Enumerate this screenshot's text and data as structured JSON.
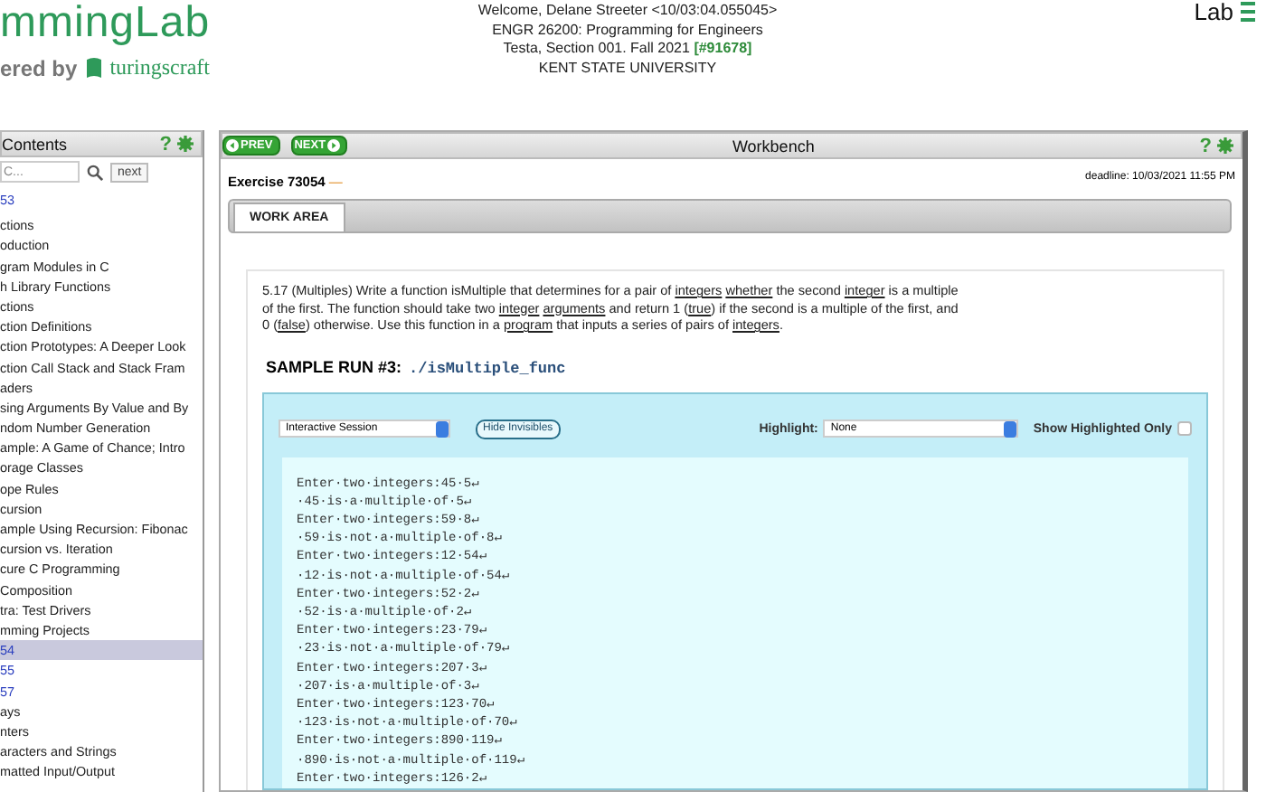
{
  "header": {
    "logo": "mmingLab",
    "powered_by": "ered by",
    "brand": "turingscraft",
    "course_lines": [
      "Welcome, Delane Streeter <10/03:04.055045>",
      "ENGR 26200: Programming for Engineers"
    ],
    "section": "Testa, Section 001. Fall 2021",
    "section_code": "[#91678]",
    "university": "KENT STATE UNIVERSITY",
    "menu_label": "Lab"
  },
  "sidebar": {
    "title": "Contents",
    "help": "?",
    "search": {
      "placeholder": "C..."
    },
    "next_button": "next",
    "items": [
      {
        "label": "53",
        "kind": "exercise",
        "selected": false
      },
      {
        "label": "ctions",
        "kind": "chapter",
        "selected": false
      },
      {
        "label": "oduction",
        "kind": "section",
        "selected": false
      },
      {
        "label": "gram Modules in C",
        "kind": "section",
        "selected": false
      },
      {
        "label": "h Library Functions",
        "kind": "section",
        "selected": false
      },
      {
        "label": "ctions",
        "kind": "section",
        "selected": false
      },
      {
        "label": "ction Definitions",
        "kind": "section",
        "selected": false
      },
      {
        "label": "ction Prototypes: A Deeper Look",
        "kind": "section",
        "selected": false
      },
      {
        "label": "ction Call Stack and Stack Fram",
        "kind": "section",
        "selected": false
      },
      {
        "label": "aders",
        "kind": "section",
        "selected": false
      },
      {
        "label": "sing Arguments By Value and By",
        "kind": "section",
        "selected": false
      },
      {
        "label": "ndom Number Generation",
        "kind": "section",
        "selected": false
      },
      {
        "label": "ample: A Game of Chance; Intro",
        "kind": "section",
        "selected": false
      },
      {
        "label": "orage Classes",
        "kind": "section",
        "selected": false
      },
      {
        "label": "ope Rules",
        "kind": "section",
        "selected": false
      },
      {
        "label": "cursion",
        "kind": "section",
        "selected": false
      },
      {
        "label": "ample Using Recursion: Fibonac",
        "kind": "section",
        "selected": false
      },
      {
        "label": "cursion vs. Iteration",
        "kind": "section",
        "selected": false
      },
      {
        "label": "cure C Programming",
        "kind": "section",
        "selected": false
      },
      {
        "label": "Composition",
        "kind": "section",
        "selected": false
      },
      {
        "label": "tra: Test Drivers",
        "kind": "section",
        "selected": false
      },
      {
        "label": "mming Projects",
        "kind": "section",
        "selected": false
      },
      {
        "label": "54",
        "kind": "exercise",
        "selected": true
      },
      {
        "label": "55",
        "kind": "exercise",
        "selected": false
      },
      {
        "label": "57",
        "kind": "exercise",
        "selected": false
      },
      {
        "label": "ays",
        "kind": "chapter",
        "selected": false
      },
      {
        "label": "nters",
        "kind": "chapter",
        "selected": false
      },
      {
        "label": "aracters and Strings",
        "kind": "chapter",
        "selected": false
      },
      {
        "label": "matted Input/Output",
        "kind": "chapter",
        "selected": false
      }
    ]
  },
  "workbench": {
    "prev": "PREV",
    "next": "NEXT",
    "title": "Workbench",
    "help": "?",
    "exercise": "Exercise 73054",
    "exercise_mark": "—",
    "deadline": "deadline: 10/03/2021 11:55 PM",
    "tabs": [
      {
        "label": "WORK AREA",
        "selected": true
      }
    ],
    "problem": [
      {
        "text": "5.17 (Multiples) Write a function isMultiple that determines for a pair of ",
        "kind": "plain"
      },
      {
        "text": "integers",
        "kind": "link"
      },
      {
        "text": "whether",
        "kind": "link"
      },
      {
        "text": " the second ",
        "kind": "plain"
      },
      {
        "text": "integer",
        "kind": "link"
      },
      {
        "text": " is a multiple of the first. The function should take two ",
        "kind": "plain"
      },
      {
        "text": "integer",
        "kind": "link"
      },
      {
        "text": "arguments",
        "kind": "link"
      },
      {
        "text": " and return 1 (",
        "kind": "plain"
      },
      {
        "text": "true",
        "kind": "link"
      },
      {
        "text": ") if the second is a multiple of the first, and 0 (",
        "kind": "plain"
      },
      {
        "text": "false",
        "kind": "link"
      },
      {
        "text": ") otherwise. Use this function in a ",
        "kind": "plain"
      },
      {
        "text": "program",
        "kind": "link"
      },
      {
        "text": " that inputs a series of pairs of ",
        "kind": "plain"
      },
      {
        "text": "integers",
        "kind": "link"
      },
      {
        "text": ".",
        "kind": "plain"
      }
    ],
    "sample_label": "SAMPLE RUN #3:",
    "sample_command": "./isMultiple_func",
    "session_select": "Interactive Session",
    "hide_button": "Hide Invisibles",
    "highlight_label": "Highlight:",
    "highlight_select": "None",
    "show_only_label": "Show Highlighted Only",
    "show_only_checked": false,
    "transcript": [
      "Enter·two·integers:45·5↵",
      "·45·is·a·multiple·of·5↵",
      "Enter·two·integers:59·8↵",
      "·59·is·not·a·multiple·of·8↵",
      "Enter·two·integers:12·54↵",
      "·12·is·not·a·multiple·of·54↵",
      "Enter·two·integers:52·2↵",
      "·52·is·a·multiple·of·2↵",
      "Enter·two·integers:23·79↵",
      "·23·is·not·a·multiple·of·79↵",
      "Enter·two·integers:207·3↵",
      "·207·is·a·multiple·of·3↵",
      "Enter·two·integers:123·70↵",
      "·123·is·not·a·multiple·of·70↵",
      "Enter·two·integers:890·119↵",
      "·890·is·not·a·multiple·of·119↵",
      "Enter·two·integers:126·2↵"
    ]
  }
}
